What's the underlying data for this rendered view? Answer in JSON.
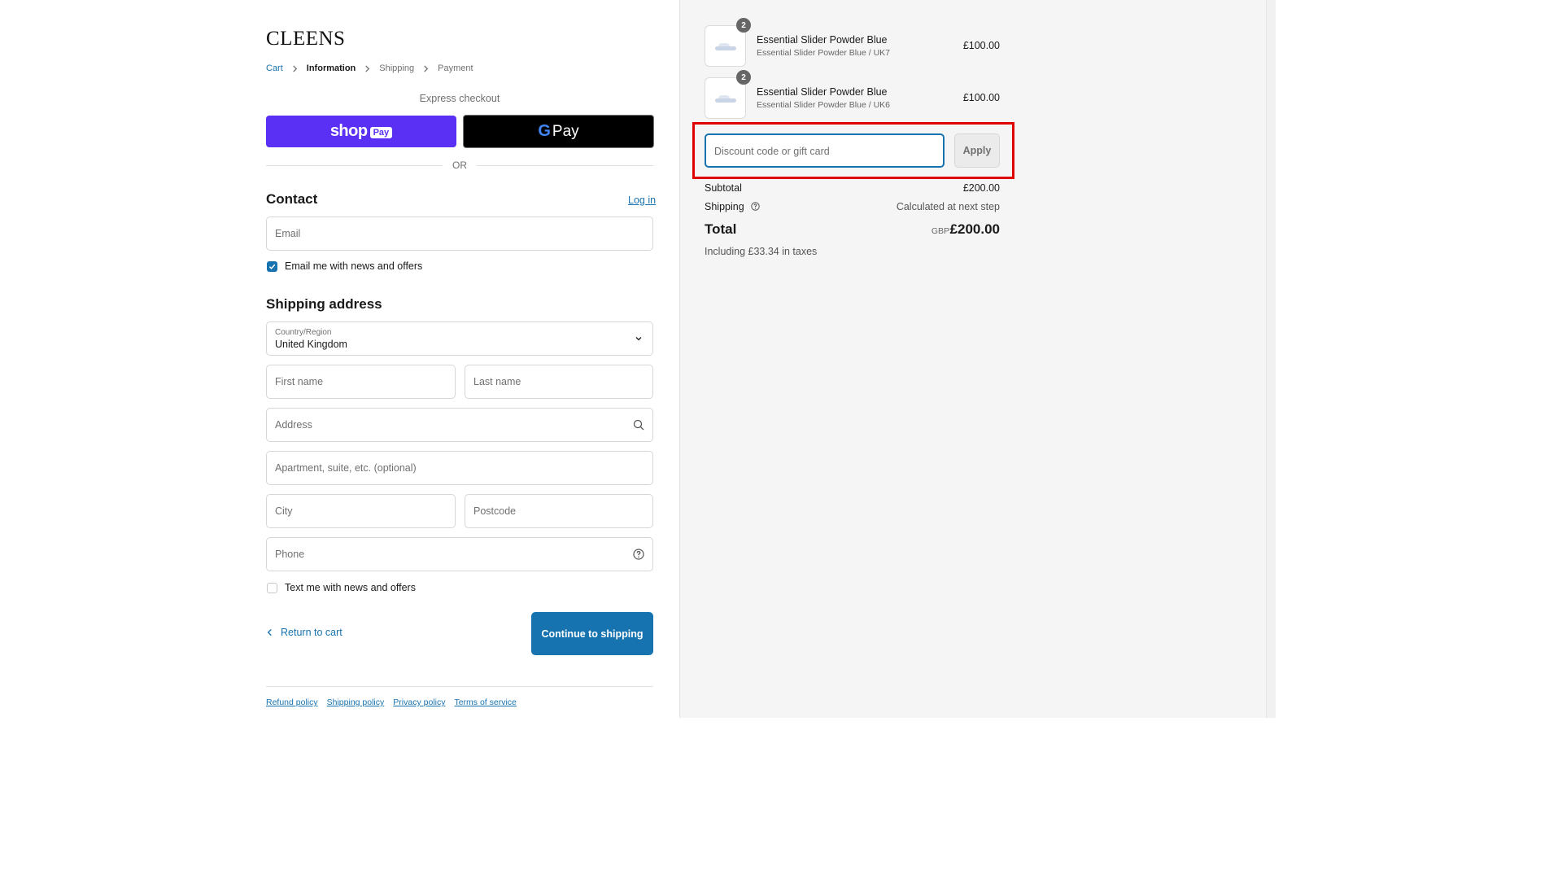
{
  "brand": {
    "name": "CLEENS"
  },
  "breadcrumb": [
    "Cart",
    "Information",
    "Shipping",
    "Payment"
  ],
  "express": {
    "title": "Express checkout",
    "shoppay_word": "shop",
    "shoppay_pill": "Pay",
    "gpay_g": "G",
    "gpay_pay": "Pay",
    "or": "OR"
  },
  "contact": {
    "heading": "Contact",
    "login": "Log in",
    "email_placeholder": "Email",
    "email_opt_in": "Email me with news and offers",
    "email_opt_in_checked": true
  },
  "shipping": {
    "heading": "Shipping address",
    "country_label": "Country/Region",
    "country_value": "United Kingdom",
    "first_name": "First name",
    "last_name": "Last name",
    "address": "Address",
    "apartment": "Apartment, suite, etc. (optional)",
    "city": "City",
    "postcode": "Postcode",
    "phone": "Phone",
    "text_opt_in": "Text me with news and offers",
    "text_opt_in_checked": false
  },
  "actions": {
    "return": "Return to cart",
    "continue": "Continue to shipping"
  },
  "footer": [
    "Refund policy",
    "Shipping policy",
    "Privacy policy",
    "Terms of service"
  ],
  "summary": {
    "items": [
      {
        "qty": "2",
        "name": "Essential Slider Powder Blue",
        "variant": "Essential Slider Powder Blue / UK7",
        "price": "£100.00"
      },
      {
        "qty": "2",
        "name": "Essential Slider Powder Blue",
        "variant": "Essential Slider Powder Blue / UK6",
        "price": "£100.00"
      }
    ],
    "discount_placeholder": "Discount code or gift card",
    "apply": "Apply",
    "subtotal_label": "Subtotal",
    "subtotal_value": "£200.00",
    "shipping_label": "Shipping",
    "shipping_value": "Calculated at next step",
    "total_label": "Total",
    "currency": "GBP",
    "total_value": "£200.00",
    "taxes": "Including £33.34 in taxes"
  },
  "colors": {
    "accent": "#1773b0",
    "shoppay": "#5a31f4",
    "highlight": "#e00000"
  }
}
